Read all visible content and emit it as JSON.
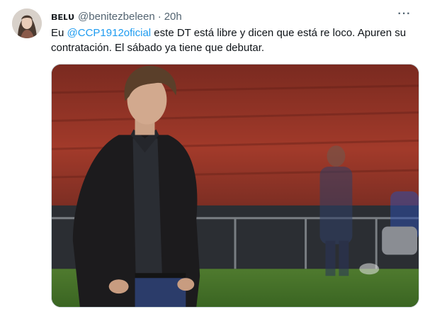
{
  "tweet": {
    "display_name": "ʙᴇʟᴜ",
    "handle": "@benitezbeleen",
    "separator": "·",
    "time": "20h",
    "more_label": "···",
    "text_prefix": "Eu ",
    "mention": "@CCP1912oficial",
    "text_suffix": " este DT está libre y dicen que está re loco. Apuren su contratación. El sábado ya tiene que debutar."
  },
  "colors": {
    "accent": "#1d9bf0",
    "secondary_text": "#536471"
  },
  "icons": {
    "more": "more-horizontal-icon"
  }
}
